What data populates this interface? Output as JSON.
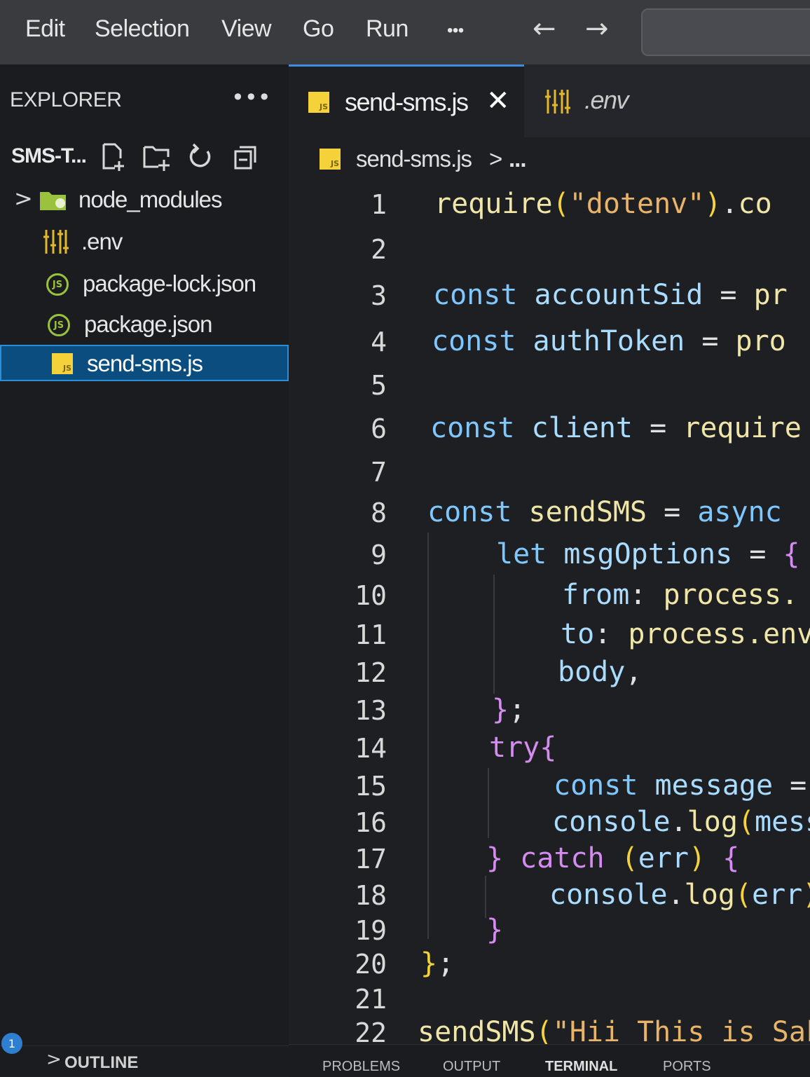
{
  "menubar": {
    "items": [
      "Edit",
      "Selection",
      "View",
      "Go",
      "Run",
      "•••"
    ],
    "back_arrow": "←",
    "forward_arrow": "→"
  },
  "sidebar": {
    "title": "EXPLORER",
    "more": "•••",
    "folder": "SMS-T...",
    "folder_actions": [
      "new-file-icon",
      "new-folder-icon",
      "refresh-icon",
      "collapse-all-icon"
    ],
    "items": [
      {
        "label": "node_modules",
        "icon": "folder-icon"
      },
      {
        "label": ".env",
        "icon": "env-icon"
      },
      {
        "label": "package-lock.json",
        "icon": "nodejs-icon"
      },
      {
        "label": "package.json",
        "icon": "nodejs-icon"
      },
      {
        "label": "send-sms.js",
        "icon": "js-file-icon"
      }
    ],
    "outline_label": "OUTLINE",
    "notification_count": "1"
  },
  "tabs": [
    {
      "label": "send-sms.js",
      "close": "✕"
    },
    {
      "label": ".env"
    }
  ],
  "breadcrumb": {
    "file": "send-sms.js",
    "separator": ">",
    "rest": "..."
  },
  "editor": {
    "line_numbers": [
      "1",
      "2",
      "3",
      "4",
      "5",
      "6",
      "7",
      "8",
      "9",
      "10",
      "11",
      "12",
      "13",
      "14",
      "15",
      "16",
      "17",
      "18",
      "19",
      "20",
      "21",
      "22"
    ],
    "lines": [
      [
        [
          "fn",
          "require"
        ],
        [
          "paren",
          "("
        ],
        [
          "str",
          "\"dotenv\""
        ],
        [
          "paren",
          ")"
        ],
        [
          "op",
          "."
        ],
        [
          "fn",
          "co"
        ]
      ],
      [],
      [
        [
          "kw",
          "const "
        ],
        [
          "id",
          "accountSid"
        ],
        [
          "op",
          " = "
        ],
        [
          "fn",
          "pr"
        ]
      ],
      [
        [
          "kw",
          "const "
        ],
        [
          "id",
          "authToken"
        ],
        [
          "op",
          " = "
        ],
        [
          "fn",
          "pro"
        ]
      ],
      [],
      [
        [
          "kw",
          "const "
        ],
        [
          "id",
          "client"
        ],
        [
          "op",
          " = "
        ],
        [
          "fn",
          "require"
        ]
      ],
      [],
      [
        [
          "kw",
          "const "
        ],
        [
          "fn",
          "sendSMS"
        ],
        [
          "op",
          " = "
        ],
        [
          "kw",
          "async"
        ]
      ],
      [
        [
          "kw",
          "let "
        ],
        [
          "id",
          "msgOptions"
        ],
        [
          "op",
          " = "
        ],
        [
          "brace",
          "{"
        ]
      ],
      [
        [
          "id",
          "from"
        ],
        [
          "op",
          ": "
        ],
        [
          "fn",
          "process."
        ]
      ],
      [
        [
          "id",
          "to"
        ],
        [
          "op",
          ": "
        ],
        [
          "fn",
          "process.env"
        ]
      ],
      [
        [
          "id",
          "body"
        ],
        [
          "op",
          ","
        ]
      ],
      [
        [
          "brace",
          "}"
        ],
        [
          "op",
          ";"
        ]
      ],
      [
        [
          "kw2",
          "try"
        ],
        [
          "brace",
          "{"
        ]
      ],
      [
        [
          "kw",
          "const "
        ],
        [
          "id",
          "message"
        ],
        [
          "op",
          " ="
        ]
      ],
      [
        [
          "id",
          "console"
        ],
        [
          "op",
          "."
        ],
        [
          "fn",
          "log"
        ],
        [
          "paren",
          "("
        ],
        [
          "id",
          "mess"
        ]
      ],
      [
        [
          "brace",
          "}"
        ],
        [
          "kw2",
          " catch "
        ],
        [
          "paren",
          "("
        ],
        [
          "id",
          "err"
        ],
        [
          "paren",
          ")"
        ],
        [
          "brace",
          " {"
        ]
      ],
      [
        [
          "id",
          "console"
        ],
        [
          "op",
          "."
        ],
        [
          "fn",
          "log"
        ],
        [
          "paren",
          "("
        ],
        [
          "id",
          "err"
        ],
        [
          "paren",
          ")"
        ]
      ],
      [
        [
          "brace",
          "}"
        ]
      ],
      [
        [
          "paren",
          "}"
        ],
        [
          "op",
          ";"
        ]
      ],
      [],
      [
        [
          "fn",
          "sendSMS"
        ],
        [
          "paren",
          "("
        ],
        [
          "str",
          "\"Hii This is Saks"
        ]
      ]
    ]
  },
  "panel": {
    "tabs": [
      "PROBLEMS",
      "OUTPUT",
      "TERMINAL",
      "PORTS"
    ]
  }
}
